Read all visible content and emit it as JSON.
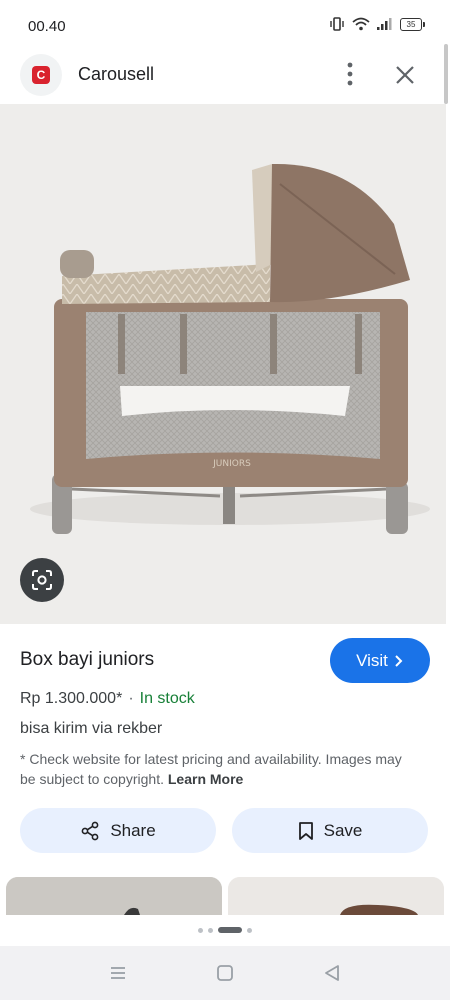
{
  "status_bar": {
    "time": "00.40",
    "battery": "35"
  },
  "header": {
    "site_name": "Carousell",
    "logo_letter": "C"
  },
  "product": {
    "title": "Box bayi juniors",
    "price": "Rp 1.300.000*",
    "separator": "·",
    "stock": "In stock",
    "description": "bisa kirim via rekber",
    "disclaimer": "* Check website for latest pricing and availability. Images may be subject to copyright.",
    "learn_more": "Learn More",
    "brand_print": "JUNIORS"
  },
  "actions": {
    "visit": "Visit",
    "share": "Share",
    "save": "Save"
  },
  "icons": {
    "more": "more-vert-icon",
    "close": "close-icon",
    "lens": "lens-search-icon",
    "share": "share-icon",
    "save": "bookmark-icon",
    "visit_chevron": "chevron-right-icon"
  },
  "colors": {
    "accent": "#1a73e8",
    "stock": "#188038",
    "brand": "#d9232e",
    "button_bg": "#e8f0fe"
  }
}
